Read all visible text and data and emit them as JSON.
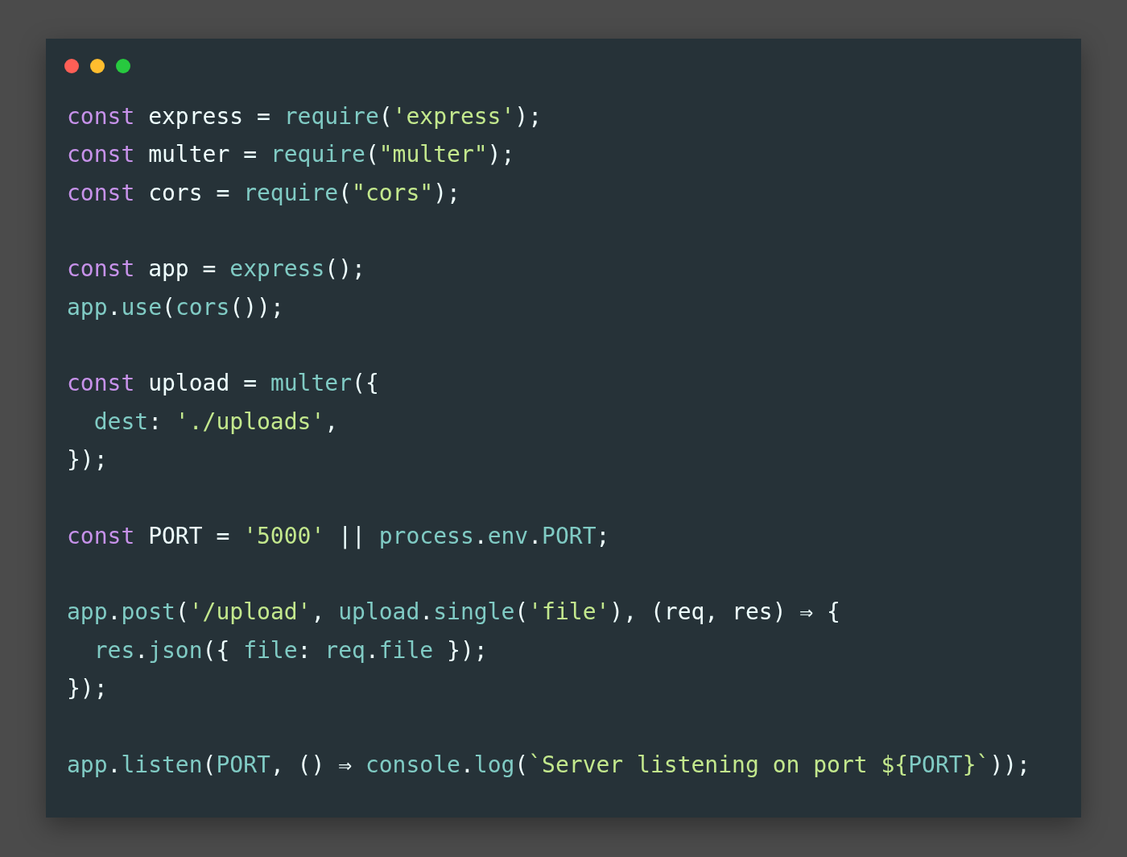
{
  "window": {
    "controls": [
      {
        "color": "#ff5f56"
      },
      {
        "color": "#ffbd2e"
      },
      {
        "color": "#27c93f"
      }
    ]
  },
  "code": {
    "lines": [
      {
        "kind": "code",
        "tokens": [
          {
            "kind": "keyword",
            "text": "const"
          },
          {
            "kind": "plain",
            "text": " express = "
          },
          {
            "kind": "func",
            "text": "require"
          },
          {
            "kind": "plain",
            "text": "("
          },
          {
            "kind": "string",
            "text": "'express'"
          },
          {
            "kind": "plain",
            "text": ");"
          }
        ]
      },
      {
        "kind": "code",
        "tokens": [
          {
            "kind": "keyword",
            "text": "const"
          },
          {
            "kind": "plain",
            "text": " multer = "
          },
          {
            "kind": "func",
            "text": "require"
          },
          {
            "kind": "plain",
            "text": "("
          },
          {
            "kind": "string",
            "text": "\"multer\""
          },
          {
            "kind": "plain",
            "text": ");"
          }
        ]
      },
      {
        "kind": "code",
        "tokens": [
          {
            "kind": "keyword",
            "text": "const"
          },
          {
            "kind": "plain",
            "text": " cors = "
          },
          {
            "kind": "func",
            "text": "require"
          },
          {
            "kind": "plain",
            "text": "("
          },
          {
            "kind": "string",
            "text": "\"cors\""
          },
          {
            "kind": "plain",
            "text": ");"
          }
        ]
      },
      {
        "kind": "blank"
      },
      {
        "kind": "code",
        "tokens": [
          {
            "kind": "keyword",
            "text": "const"
          },
          {
            "kind": "plain",
            "text": " app = "
          },
          {
            "kind": "func",
            "text": "express"
          },
          {
            "kind": "plain",
            "text": "();"
          }
        ]
      },
      {
        "kind": "code",
        "tokens": [
          {
            "kind": "func",
            "text": "app"
          },
          {
            "kind": "plain",
            "text": "."
          },
          {
            "kind": "func",
            "text": "use"
          },
          {
            "kind": "plain",
            "text": "("
          },
          {
            "kind": "func",
            "text": "cors"
          },
          {
            "kind": "plain",
            "text": "());"
          }
        ]
      },
      {
        "kind": "blank"
      },
      {
        "kind": "code",
        "tokens": [
          {
            "kind": "keyword",
            "text": "const"
          },
          {
            "kind": "plain",
            "text": " upload = "
          },
          {
            "kind": "func",
            "text": "multer"
          },
          {
            "kind": "plain",
            "text": "({"
          }
        ]
      },
      {
        "kind": "code",
        "indented": true,
        "tokens": [
          {
            "kind": "func",
            "text": "dest"
          },
          {
            "kind": "plain",
            "text": ": "
          },
          {
            "kind": "string",
            "text": "'./uploads'"
          },
          {
            "kind": "plain",
            "text": ","
          }
        ]
      },
      {
        "kind": "code",
        "tokens": [
          {
            "kind": "plain",
            "text": "});"
          }
        ]
      },
      {
        "kind": "blank"
      },
      {
        "kind": "code",
        "tokens": [
          {
            "kind": "keyword",
            "text": "const"
          },
          {
            "kind": "plain",
            "text": " PORT = "
          },
          {
            "kind": "string",
            "text": "'5000'"
          },
          {
            "kind": "plain",
            "text": " || "
          },
          {
            "kind": "func",
            "text": "process"
          },
          {
            "kind": "plain",
            "text": "."
          },
          {
            "kind": "func",
            "text": "env"
          },
          {
            "kind": "plain",
            "text": "."
          },
          {
            "kind": "func",
            "text": "PORT"
          },
          {
            "kind": "plain",
            "text": ";"
          }
        ]
      },
      {
        "kind": "blank"
      },
      {
        "kind": "code",
        "tokens": [
          {
            "kind": "func",
            "text": "app"
          },
          {
            "kind": "plain",
            "text": "."
          },
          {
            "kind": "func",
            "text": "post"
          },
          {
            "kind": "plain",
            "text": "("
          },
          {
            "kind": "string",
            "text": "'/upload'"
          },
          {
            "kind": "plain",
            "text": ", "
          },
          {
            "kind": "func",
            "text": "upload"
          },
          {
            "kind": "plain",
            "text": "."
          },
          {
            "kind": "func",
            "text": "single"
          },
          {
            "kind": "plain",
            "text": "("
          },
          {
            "kind": "string",
            "text": "'file'"
          },
          {
            "kind": "plain",
            "text": "), (req, res) ⇒ {"
          }
        ]
      },
      {
        "kind": "code",
        "indented": true,
        "tokens": [
          {
            "kind": "func",
            "text": "res"
          },
          {
            "kind": "plain",
            "text": "."
          },
          {
            "kind": "func",
            "text": "json"
          },
          {
            "kind": "plain",
            "text": "({ "
          },
          {
            "kind": "func",
            "text": "file"
          },
          {
            "kind": "plain",
            "text": ": "
          },
          {
            "kind": "func",
            "text": "req"
          },
          {
            "kind": "plain",
            "text": "."
          },
          {
            "kind": "func",
            "text": "file"
          },
          {
            "kind": "plain",
            "text": " });"
          }
        ]
      },
      {
        "kind": "code",
        "tokens": [
          {
            "kind": "plain",
            "text": "});"
          }
        ]
      },
      {
        "kind": "blank"
      },
      {
        "kind": "code",
        "tokens": [
          {
            "kind": "func",
            "text": "app"
          },
          {
            "kind": "plain",
            "text": "."
          },
          {
            "kind": "func",
            "text": "listen"
          },
          {
            "kind": "plain",
            "text": "("
          },
          {
            "kind": "func",
            "text": "PORT"
          },
          {
            "kind": "plain",
            "text": ", () ⇒ "
          },
          {
            "kind": "func",
            "text": "console"
          },
          {
            "kind": "plain",
            "text": "."
          },
          {
            "kind": "func",
            "text": "log"
          },
          {
            "kind": "plain",
            "text": "("
          },
          {
            "kind": "string",
            "text": "`Server listening on port ${"
          },
          {
            "kind": "func",
            "text": "PORT"
          },
          {
            "kind": "string",
            "text": "}`"
          },
          {
            "kind": "plain",
            "text": "));"
          }
        ]
      }
    ]
  }
}
